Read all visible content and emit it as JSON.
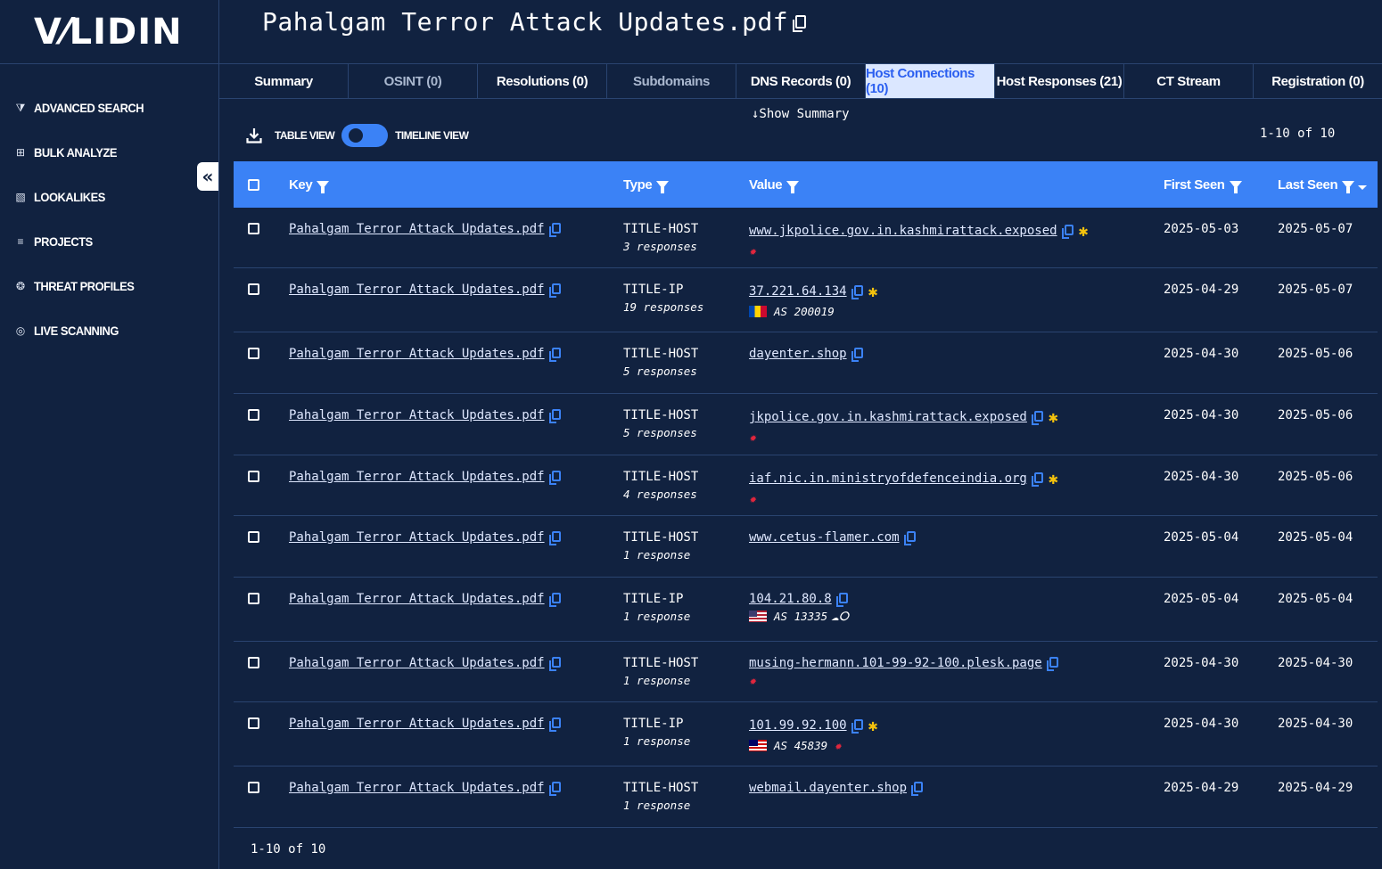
{
  "brand": {
    "logo": "V⁄LIDIN"
  },
  "sidebar": {
    "items": [
      {
        "icon": "filter-icon",
        "glyph": "⧩",
        "label": "ADVANCED SEARCH"
      },
      {
        "icon": "grid-icon",
        "glyph": "⊞",
        "label": "BULK ANALYZE"
      },
      {
        "icon": "lookalikes-icon",
        "glyph": "▧",
        "label": "LOOKALIKES"
      },
      {
        "icon": "list-icon",
        "glyph": "≡",
        "label": "PROJECTS"
      },
      {
        "icon": "bug-icon",
        "glyph": "❂",
        "label": "THREAT PROFILES"
      },
      {
        "icon": "radar-icon",
        "glyph": "◎",
        "label": "LIVE SCANNING"
      }
    ],
    "collapse_glyph": "«"
  },
  "header": {
    "title": "Pahalgam Terror Attack Updates.pdf"
  },
  "tabs": [
    {
      "label": "Summary",
      "state": "normal"
    },
    {
      "label": "OSINT (0)",
      "state": "muted"
    },
    {
      "label": "Resolutions (0)",
      "state": "normal"
    },
    {
      "label": "Subdomains",
      "state": "muted"
    },
    {
      "label": "DNS Records (0)",
      "state": "normal"
    },
    {
      "label": "Host Connections (10)",
      "state": "active"
    },
    {
      "label": "Host Responses (21)",
      "state": "normal"
    },
    {
      "label": "CT Stream",
      "state": "normal"
    },
    {
      "label": "Registration (0)",
      "state": "normal"
    }
  ],
  "toolbar": {
    "show_summary": "↓Show Summary",
    "table_view": "TABLE VIEW",
    "timeline_view": "TIMELINE VIEW",
    "pager": "1-10 of 10"
  },
  "table": {
    "headers": {
      "key": "Key",
      "type": "Type",
      "value": "Value",
      "first_seen": "First Seen",
      "last_seen": "Last Seen"
    },
    "rows": [
      {
        "key": "Pahalgam Terror Attack Updates.pdf",
        "type": "TITLE-HOST",
        "responses": "3 responses",
        "value": "www.jkpolice.gov.in.kashmirattack.exposed",
        "star": true,
        "malicious": true,
        "first": "2025-05-03",
        "last": "2025-05-07"
      },
      {
        "key": "Pahalgam Terror Attack Updates.pdf",
        "type": "TITLE-IP",
        "responses": "19 responses",
        "value": "37.221.64.134",
        "star": true,
        "flag": "md",
        "asn": "AS 200019",
        "first": "2025-04-29",
        "last": "2025-05-07"
      },
      {
        "key": "Pahalgam Terror Attack Updates.pdf",
        "type": "TITLE-HOST",
        "responses": "5 responses",
        "value": "dayenter.shop",
        "first": "2025-04-30",
        "last": "2025-05-06"
      },
      {
        "key": "Pahalgam Terror Attack Updates.pdf",
        "type": "TITLE-HOST",
        "responses": "5 responses",
        "value": "jkpolice.gov.in.kashmirattack.exposed",
        "star": true,
        "malicious": true,
        "first": "2025-04-30",
        "last": "2025-05-06"
      },
      {
        "key": "Pahalgam Terror Attack Updates.pdf",
        "type": "TITLE-HOST",
        "responses": "4 responses",
        "value": "iaf.nic.in.ministryofdefenceindia.org",
        "star": true,
        "malicious": true,
        "first": "2025-04-30",
        "last": "2025-05-06"
      },
      {
        "key": "Pahalgam Terror Attack Updates.pdf",
        "type": "TITLE-HOST",
        "responses": "1 response",
        "value": "www.cetus-flamer.com",
        "first": "2025-05-04",
        "last": "2025-05-04"
      },
      {
        "key": "Pahalgam Terror Attack Updates.pdf",
        "type": "TITLE-IP",
        "responses": "1 response",
        "value": "104.21.80.8",
        "flag": "us",
        "asn": "AS 13335",
        "cloud": true,
        "first": "2025-05-04",
        "last": "2025-05-04"
      },
      {
        "key": "Pahalgam Terror Attack Updates.pdf",
        "type": "TITLE-HOST",
        "responses": "1 response",
        "value": "musing-hermann.101-99-92-100.plesk.page",
        "malicious": true,
        "first": "2025-04-30",
        "last": "2025-04-30"
      },
      {
        "key": "Pahalgam Terror Attack Updates.pdf",
        "type": "TITLE-IP",
        "responses": "1 response",
        "value": "101.99.92.100",
        "star": true,
        "flag": "my",
        "asn": "AS 45839",
        "malicious_inline": true,
        "first": "2025-04-30",
        "last": "2025-04-30"
      },
      {
        "key": "Pahalgam Terror Attack Updates.pdf",
        "type": "TITLE-HOST",
        "responses": "1 response",
        "value": "webmail.dayenter.shop",
        "first": "2025-04-29",
        "last": "2025-04-29"
      }
    ]
  },
  "footer": {
    "pager": "1-10 of 10"
  },
  "colors": {
    "bg": "#112240",
    "accent": "#3b82f6",
    "active_tab_bg": "#dbe7ff",
    "star": "#f4c20d",
    "malicious": "#e0263d"
  }
}
